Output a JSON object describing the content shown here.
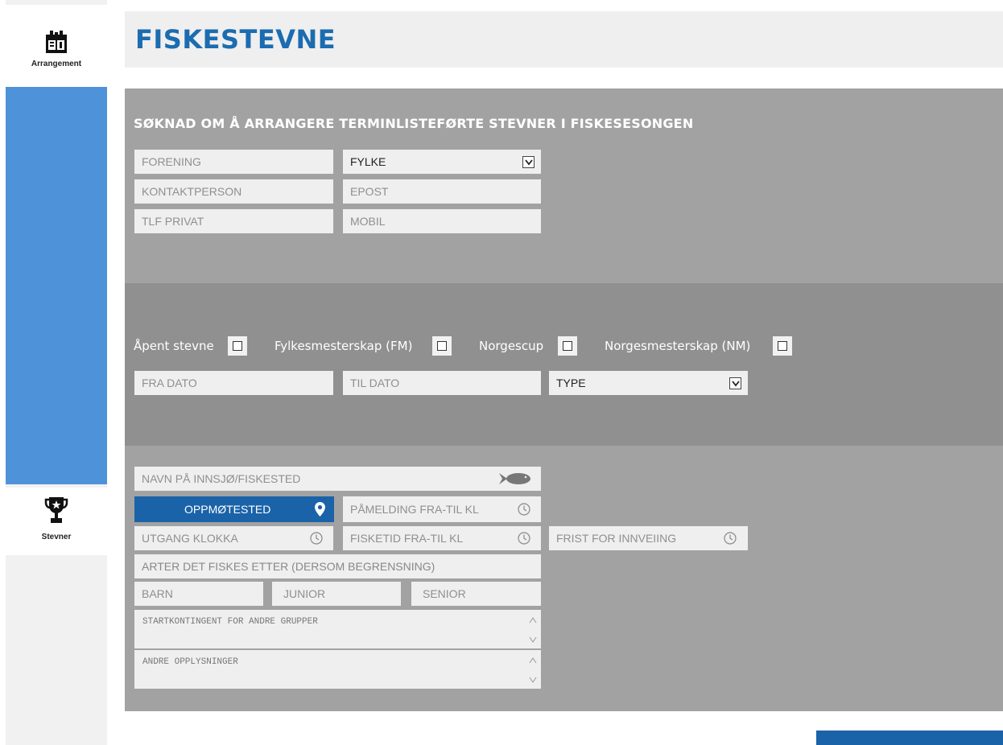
{
  "sidebar": {
    "items": [
      {
        "label": "Arrangement",
        "icon": "calendar-icon"
      },
      {
        "label": "Stevner",
        "icon": "trophy-icon"
      }
    ]
  },
  "header": {
    "title": "FISKESTEVNE"
  },
  "section": {
    "title": "SØKNAD OM Å ARRANGERE TERMINLISTEFØRTE STEVNER I FISKESESONGEN"
  },
  "contact": {
    "forening": "FORENING",
    "fylke": "FYLKE",
    "kontaktperson": "KONTAKTPERSON",
    "epost": "EPOST",
    "tlf_privat": "TLF PRIVAT",
    "mobil": "MOBIL"
  },
  "event_types": {
    "apent": "Åpent stevne",
    "fm": "Fylkesmesterskap (FM)",
    "norgescup": "Norgescup",
    "nm": "Norgesmesterskap (NM)"
  },
  "dates": {
    "fra_dato": "FRA DATO",
    "til_dato": "TIL DATO",
    "type": "TYPE"
  },
  "location": {
    "navn": "NAVN PÅ INNSJØ/FISKESTED",
    "oppmotested": "OPPMØTESTED",
    "pamelding": "PÅMELDING FRA-TIL KL",
    "utgang": "UTGANG KLOKKA",
    "fisketid": "FISKETID FRA-TIL KL",
    "frist": "FRIST FOR INNVEIING",
    "arter": "ARTER DET FISKES ETTER (DERSOM BEGRENSNING)",
    "barn": "BARN",
    "junior": "JUNIOR",
    "senior": "SENIOR",
    "startkontingent": "STARTKONTINGENT FOR ANDRE GRUPPER",
    "andre": "ANDRE OPPLYSNINGER"
  },
  "colors": {
    "accent": "#1a63a9",
    "sidebar_blue": "#4e93d9",
    "title_blue": "#1b6cb0"
  }
}
